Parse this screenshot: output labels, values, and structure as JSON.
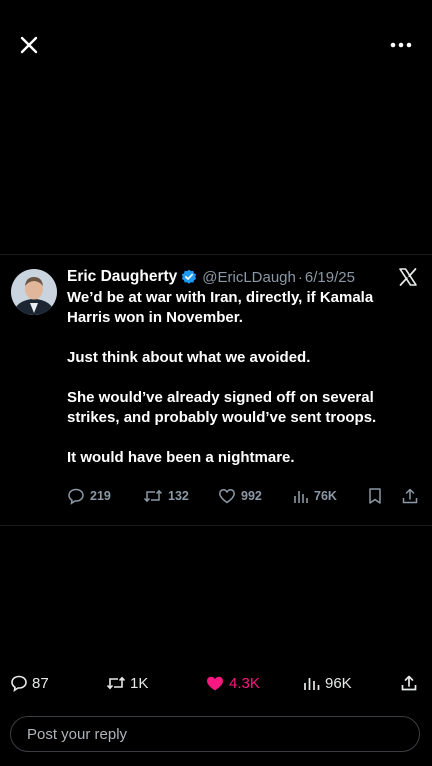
{
  "top_bar": {
    "close_icon": "close-icon",
    "more_icon": "more-horizontal-icon"
  },
  "tweet": {
    "author_name": "Eric Daugherty",
    "verified": true,
    "handle": "@EricLDaugh",
    "separator": "·",
    "date": "6/19/25",
    "body": [
      "We’d be at war with Iran, directly, if Kamala Harris won in November.",
      "Just think about what we avoided.",
      "She would’ve already signed off on several strikes, and probably would’ve sent troops.",
      "It would have been a nightmare."
    ],
    "actions": {
      "replies": "219",
      "reposts": "132",
      "likes": "992",
      "views": "76K"
    },
    "colors": {
      "verified_blue": "#1d9bf0",
      "muted": "#8b98a5"
    }
  },
  "engagement": {
    "replies": "87",
    "reposts": "1K",
    "likes": "4.3K",
    "views": "96K",
    "like_color": "#f91880"
  },
  "reply": {
    "placeholder": "Post your reply"
  }
}
